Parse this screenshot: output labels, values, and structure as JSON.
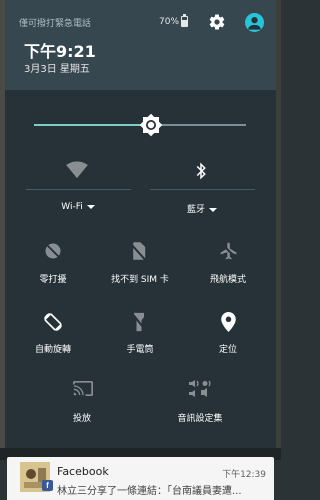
{
  "status": {
    "emergency_text": "僅可撥打緊急電話",
    "battery_percent": "70%"
  },
  "header": {
    "time": "下午9:21",
    "date": "3月3日 星期五"
  },
  "brightness": {
    "level": 0.55
  },
  "tiles": {
    "wifi": {
      "label": "Wi-Fi",
      "icon": "wifi-icon"
    },
    "bluetooth": {
      "label": "藍牙",
      "icon": "bluetooth-icon"
    },
    "dnd": {
      "label": "零打擾",
      "icon": "do-not-disturb-icon"
    },
    "sim": {
      "label": "找不到 SIM 卡",
      "icon": "no-sim-icon"
    },
    "airplane": {
      "label": "飛航模式",
      "icon": "airplane-icon"
    },
    "rotate": {
      "label": "自動旋轉",
      "icon": "auto-rotate-icon"
    },
    "flashlight": {
      "label": "手電筒",
      "icon": "flashlight-icon"
    },
    "location": {
      "label": "定位",
      "icon": "location-icon"
    },
    "cast": {
      "label": "投放",
      "icon": "cast-icon"
    },
    "sound": {
      "label": "音訊設定集",
      "icon": "sound-settings-icon"
    }
  },
  "notification": {
    "title": "Facebook",
    "time": "下午12:39",
    "text": "林立三分享了一條連結：「台南議員妻遭...",
    "badge": "f"
  },
  "colors": {
    "header": "#37474f",
    "panel": "#263238",
    "accent": "#80cbc4",
    "avatar": "#26c6da"
  }
}
